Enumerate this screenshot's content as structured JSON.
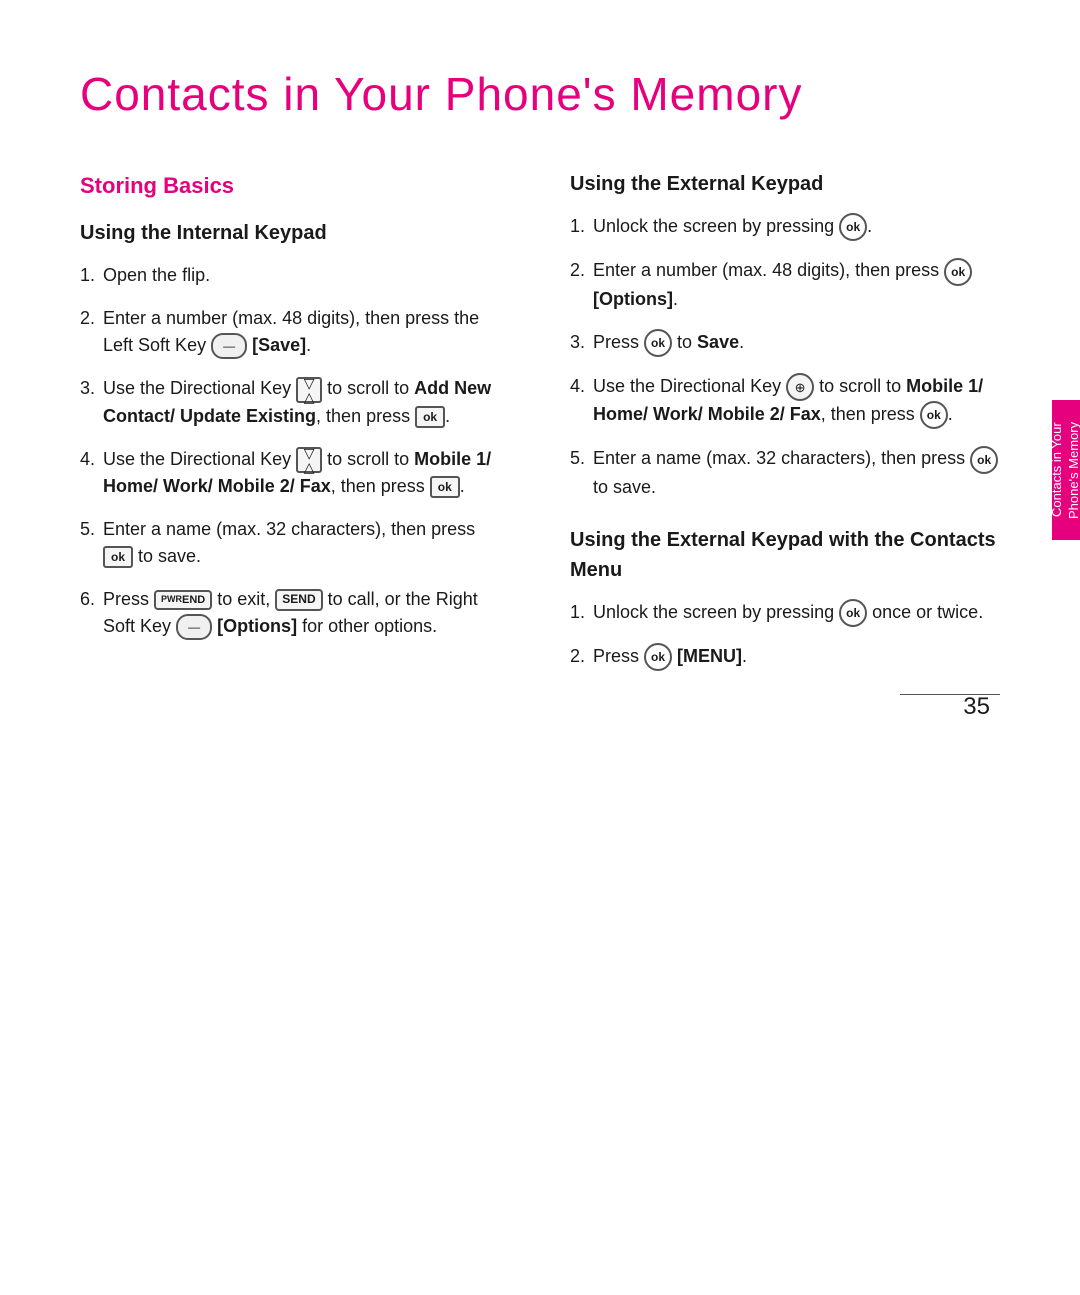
{
  "page": {
    "title": "Contacts in Your Phone's Memory",
    "page_number": "35",
    "tab_text": "Contacts in Your Phone's Memory"
  },
  "left_column": {
    "section_heading": "Storing Basics",
    "sub_heading": "Using the Internal Keypad",
    "steps": [
      {
        "num": "1.",
        "text": "Open the flip."
      },
      {
        "num": "2.",
        "text": "Enter a number (max. 48 digits), then press the Left Soft Key",
        "key_type": "soft",
        "key_label": "",
        "suffix": "[Save]."
      },
      {
        "num": "3.",
        "text": "Use the Directional Key",
        "key_type": "dir",
        "middle": "to scroll to",
        "bold_text": "Add New Contact/ Update Existing",
        "suffix": ", then press",
        "end_key": "ok_square",
        "end": "."
      },
      {
        "num": "4.",
        "text": "Use the Directional Key",
        "key_type": "dir",
        "middle": "to scroll to",
        "bold_text": "Mobile 1/ Home/ Work/ Mobile 2/ Fax",
        "suffix": ", then press",
        "end_key": "ok_square",
        "end": "."
      },
      {
        "num": "5.",
        "text": "Enter a name (max. 32 characters), then press",
        "key_type": "ok_square",
        "suffix": "to save."
      },
      {
        "num": "6.",
        "text": "Press",
        "key1_type": "pwr_end",
        "key1_label": "PWR END",
        "middle1": "to exit,",
        "key2_type": "send",
        "key2_label": "SEND",
        "middle2": "to call, or the Right Soft Key",
        "key3_type": "soft",
        "suffix": "[Options] for other options."
      }
    ]
  },
  "right_column": {
    "section1": {
      "sub_heading": "Using the External Keypad",
      "steps": [
        {
          "num": "1.",
          "text": "Unlock the screen by pressing",
          "key_type": "ok_circle",
          "suffix": "."
        },
        {
          "num": "2.",
          "text": "Enter a number (max. 48 digits), then press",
          "key_type": "ok_circle",
          "suffix": "[Options]."
        },
        {
          "num": "3.",
          "text": "Press",
          "key_type": "ok_circle",
          "bold_suffix": "to Save",
          "suffix": "."
        },
        {
          "num": "4.",
          "text": "Use the Directional Key",
          "key_type": "dir_circle",
          "middle": "to scroll to",
          "bold_text": "Mobile 1/ Home/ Work/ Mobile 2/ Fax",
          "suffix": ", then press",
          "end_key": "ok_circle",
          "end": "."
        },
        {
          "num": "5.",
          "text": "Enter a name (max. 32 characters), then press",
          "key_type": "ok_circle",
          "suffix": "to save."
        }
      ]
    },
    "section2": {
      "sub_heading": "Using the External Keypad with the Contacts Menu",
      "steps": [
        {
          "num": "1.",
          "text": "Unlock the screen by pressing",
          "key_type": "ok_circle",
          "suffix": "once or twice."
        },
        {
          "num": "2.",
          "text": "Press",
          "key_type": "ok_circle",
          "bold_suffix": "[MENU]",
          "suffix": "."
        }
      ]
    }
  }
}
